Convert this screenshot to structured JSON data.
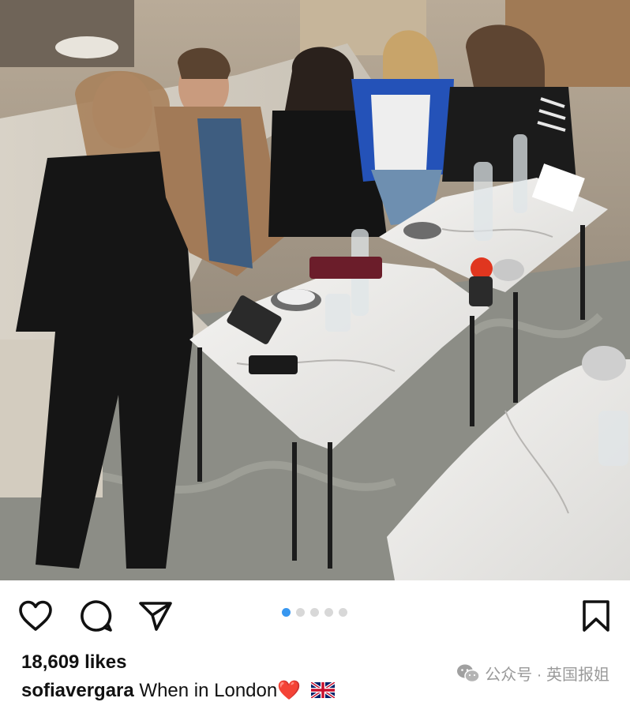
{
  "post": {
    "likes_text": "18,609 likes",
    "username": "sofiavergara",
    "caption_text": "When in London",
    "caption_emoji_heart": "❤️",
    "carousel": {
      "total": 5,
      "active_index": 0
    },
    "photo_description_icon": "group-photo"
  },
  "actions": {
    "like": "heart-outline-icon",
    "comment": "speech-bubble-icon",
    "share": "paper-plane-icon",
    "save": "bookmark-outline-icon"
  },
  "watermark": {
    "text": "公众号 · 英国报姐",
    "icon": "wechat-icon"
  },
  "colors": {
    "carousel_active": "#3897f0",
    "carousel_inactive": "#d8d8d8",
    "text": "#111111",
    "watermark": "#9a9a9a"
  }
}
